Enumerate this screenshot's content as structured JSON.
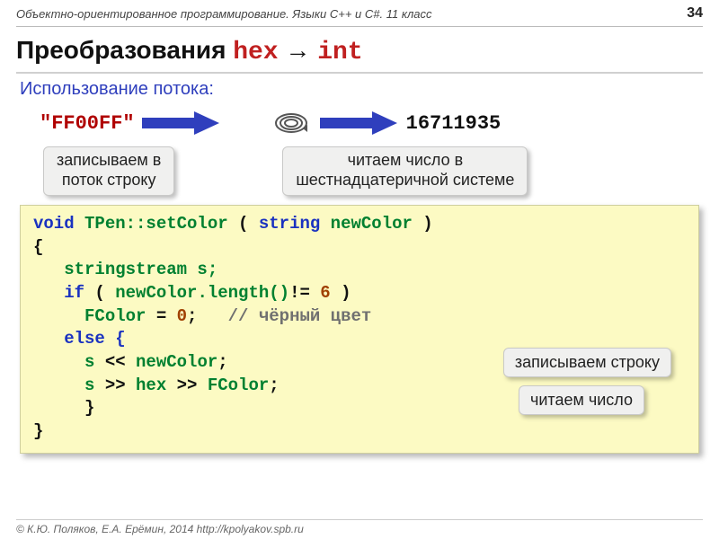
{
  "header": {
    "course": "Объектно-ориентированное программирование. Языки C++ и C#. 11 класс",
    "page_number": "34"
  },
  "title": {
    "prefix": "Преобразования ",
    "hex": "hex",
    "arrow": " → ",
    "int": "int"
  },
  "subtitle": "Использование потока:",
  "example": {
    "hex_string": "\"FF00FF\"",
    "int_value": "16711935"
  },
  "callouts": {
    "write": "записываем в\nпоток строку",
    "read": "читаем число в\nшестнадцатеричной системе",
    "write_inline": "записываем строку",
    "read_inline": "читаем число"
  },
  "code": {
    "l1a": "void",
    "l1b": " TPen::setColor",
    "l1c": " ( ",
    "l1d": "string",
    "l1e": " newColor",
    "l1f": " )",
    "l2": "{",
    "l3": "   stringstream s;",
    "l4a": "   if",
    "l4b": " ( ",
    "l4c": "newColor.length()",
    "l4d": "!= ",
    "l4e": "6",
    "l4f": " )",
    "l5a": "     FColor",
    "l5b": " = ",
    "l5c": "0",
    "l5d": ";   ",
    "l5e": "// чёрный цвет",
    "l6": "   else {",
    "l7a": "     s",
    "l7b": " << ",
    "l7c": "newColor",
    "l7d": ";",
    "l8a": "     s",
    "l8b": " >> ",
    "l8c": "hex",
    "l8d": " >> ",
    "l8e": "FColor",
    "l8f": ";",
    "l9": "     }",
    "l10": "}"
  },
  "footer": {
    "text": "© К.Ю. Поляков, Е.А. Ерёмин, 2014    http://kpolyakov.spb.ru"
  }
}
